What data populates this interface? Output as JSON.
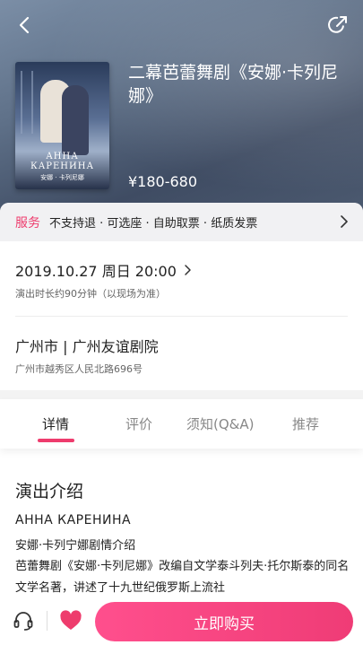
{
  "header": {
    "back_icon": "chevron-left-icon",
    "share_icon": "share-icon"
  },
  "show": {
    "title": "二幕芭蕾舞剧《安娜·卡列尼娜》",
    "price": "¥180-680",
    "poster": {
      "title_line1": "АННА",
      "title_line2": "КАРЕНИНА",
      "subtitle": "安娜 · 卡列尼娜"
    }
  },
  "service": {
    "label": "服务",
    "text": "不支持退 · 可选座 · 自助取票 · 纸质发票"
  },
  "schedule": {
    "datetime": "2019.10.27 周日 20:00",
    "duration": "演出时长约90分钟（以现场为准）"
  },
  "venue": {
    "name": "广州市 | 广州友谊剧院",
    "address": "广州市越秀区人民北路696号"
  },
  "tabs": [
    {
      "label": "详情"
    },
    {
      "label": "评价"
    },
    {
      "label": "须知(Q&A)"
    },
    {
      "label": "推荐"
    }
  ],
  "details": {
    "section_title": "演出介绍",
    "line1": "АННА КАРЕНИНА",
    "line2": "安娜·卡列宁娜剧情介绍",
    "line3": "芭蕾舞剧《安娜·卡列尼娜》改编自文学泰斗列夫·托尔斯泰的同名文学名著，讲述了十九世纪俄罗斯上流社"
  },
  "bottom_bar": {
    "buy_label": "立即购买",
    "customer_service_icon": "headset-icon",
    "favorite_icon": "heart-icon"
  },
  "colors": {
    "accent": "#ee3c6d",
    "buy_button": "#f2467f"
  }
}
